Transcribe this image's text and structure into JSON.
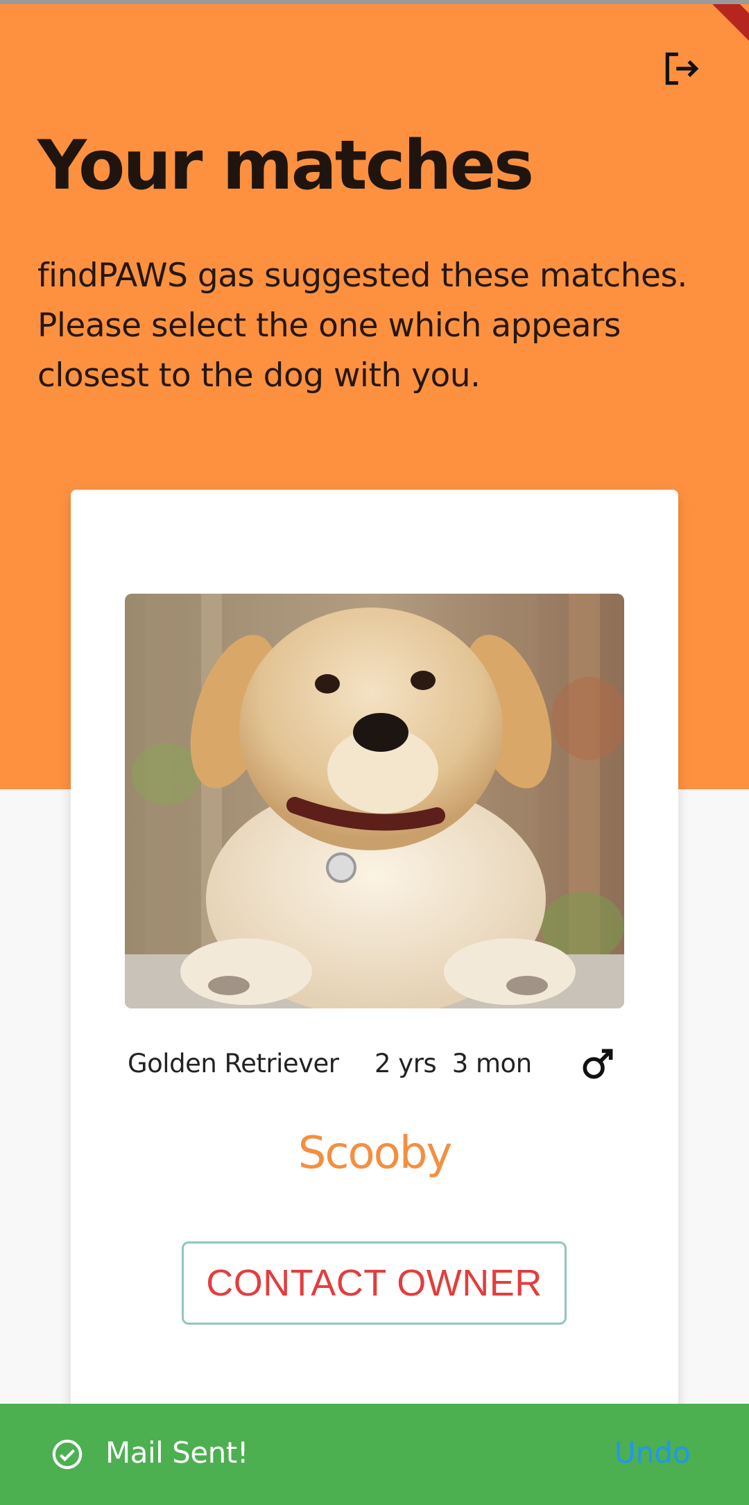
{
  "header": {
    "title": "Your matches",
    "subtitle": "findPAWS gas suggested these matches. Please select the one which appears closest to the dog with you."
  },
  "icons": {
    "logout": "logout-icon",
    "gender": "male-icon",
    "snackbar": "check-circle-icon"
  },
  "match": {
    "breed": "Golden Retriever",
    "age": "2 yrs  3 mon",
    "name": "Scooby",
    "contact_label": "CONTACT OWNER"
  },
  "snackbar": {
    "message": "Mail Sent!",
    "action": "Undo"
  },
  "colors": {
    "header_bg": "#fd9140",
    "name_accent": "#f48f41",
    "button_text": "#e33d3d",
    "button_border": "#8fc6c0",
    "snackbar_bg": "#4caf50",
    "snackbar_action": "#2196f3"
  }
}
